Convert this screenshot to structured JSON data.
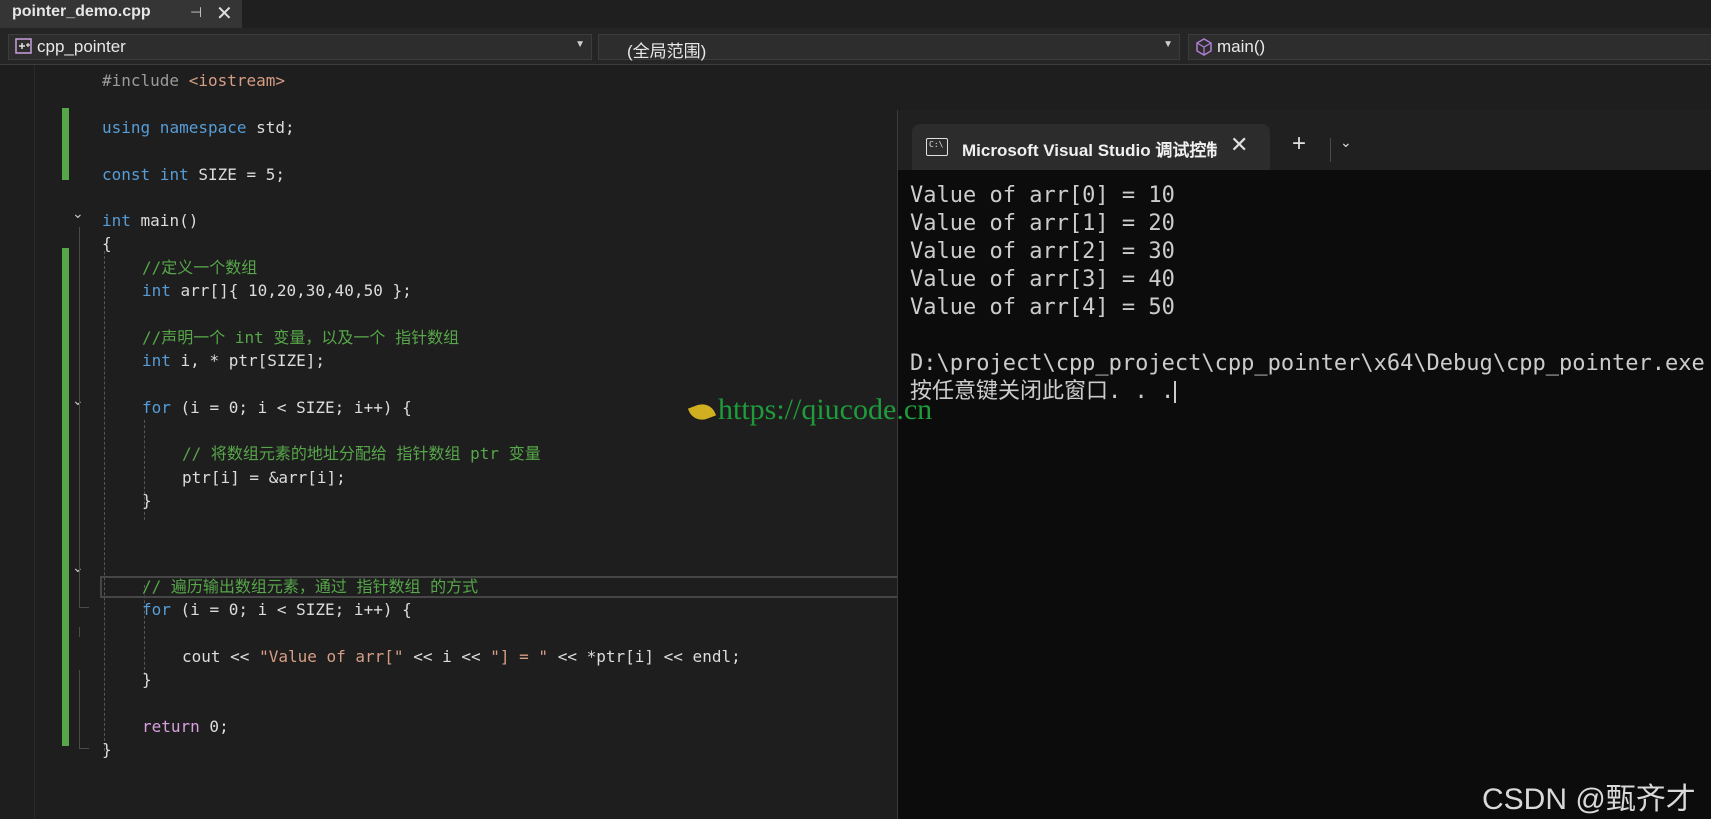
{
  "tab": {
    "title": "pointer_demo.cpp",
    "pin": "⊣",
    "close": "✕"
  },
  "nav": {
    "project": "cpp_pointer",
    "scope": "(全局范围)",
    "function": "main()"
  },
  "code": {
    "l1_pp": "#include",
    "l1_inc": " <iostream>",
    "l2_kw1": "using",
    "l2_kw2": " namespace",
    "l2_rest": " std;",
    "l3_kw1": "const",
    "l3_kw2": " int",
    "l3_rest": " SIZE = 5;",
    "l4_kw": "int",
    "l4_rest": " main()",
    "l5": "{",
    "l6": "//定义一个数组",
    "l7_kw": "int",
    "l7_rest": " arr[]{ 10,20,30,40,50 };",
    "l8": "//声明一个 int 变量，以及一个 指针数组",
    "l9_kw": "int",
    "l9_rest": " i, * ptr[SIZE];",
    "l10_kw": "for",
    "l10_rest": " (i = 0; i < SIZE; i++) {",
    "l11": "// 将数组元素的地址分配给 指针数组 ptr 变量",
    "l12": "ptr[i] = &arr[i];",
    "l13": "}",
    "l14": "// 遍历输出数组元素，通过 指针数组 的方式",
    "l15_kw": "for",
    "l15_rest": " (i = 0; i < SIZE; i++) {",
    "l16_a": "cout << ",
    "l16_s1": "\"Value of arr[\"",
    "l16_b": " << i << ",
    "l16_s2": "\"] = \"",
    "l16_c": " << *ptr[i] << endl;",
    "l17": "}",
    "l18_kw": "return",
    "l18_rest": " 0;",
    "l19": "}"
  },
  "console": {
    "title": "Microsoft Visual Studio 调试控制台",
    "icon_text": "C:\\",
    "close": "✕",
    "plus": "+",
    "chevron": "⌄",
    "lines": [
      "Value of arr[0] = 10",
      "Value of arr[1] = 20",
      "Value of arr[2] = 30",
      "Value of arr[3] = 40",
      "Value of arr[4] = 50",
      "",
      "D:\\project\\cpp_project\\cpp_pointer\\x64\\Debug\\cpp_pointer.exe",
      "按任意键关闭此窗口. . ."
    ]
  },
  "watermark": "https://qiucode.cn",
  "credit": "CSDN @甄齐才",
  "colors": {
    "accent_green": "#57a64a",
    "keyword": "#569cd6",
    "string": "#d69d85"
  }
}
